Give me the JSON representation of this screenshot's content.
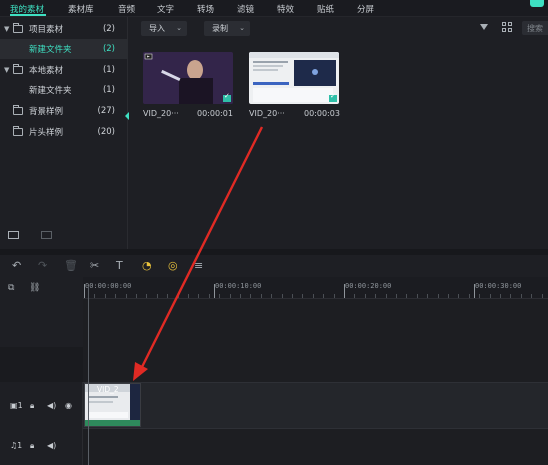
{
  "top_tabs": [
    "我的素材",
    "素材库",
    "音频",
    "文字",
    "转场",
    "滤镜",
    "特效",
    "贴纸",
    "分屏"
  ],
  "folders": [
    {
      "label": "项目素材",
      "count": "(2)",
      "expanded": true
    },
    {
      "label": "新建文件夹",
      "count": "(2)",
      "selected": true
    },
    {
      "label": "本地素材",
      "count": "(1)",
      "expanded": true
    },
    {
      "label": "新建文件夹",
      "count": "(1)"
    },
    {
      "label": "背景样例",
      "count": "(27)"
    },
    {
      "label": "片头样例",
      "count": "(20)"
    }
  ],
  "media_toolbar": {
    "import_label": "导入",
    "record_label": "录制",
    "search_placeholder": "搜索"
  },
  "media_items": [
    {
      "name": "VID_20···",
      "duration": "00:00:01"
    },
    {
      "name": "VID_20···",
      "duration": "00:00:03"
    }
  ],
  "ruler_labels": [
    "00:00:00:00",
    "00:00:10:00",
    "00:00:20:00",
    "00:00:30:00"
  ],
  "tracks": {
    "video_label": "1",
    "audio_label": "1",
    "clip_name": "VID_2"
  },
  "colors": {
    "accent": "#3ee0c2",
    "annotation_arrow": "#e02a24"
  }
}
